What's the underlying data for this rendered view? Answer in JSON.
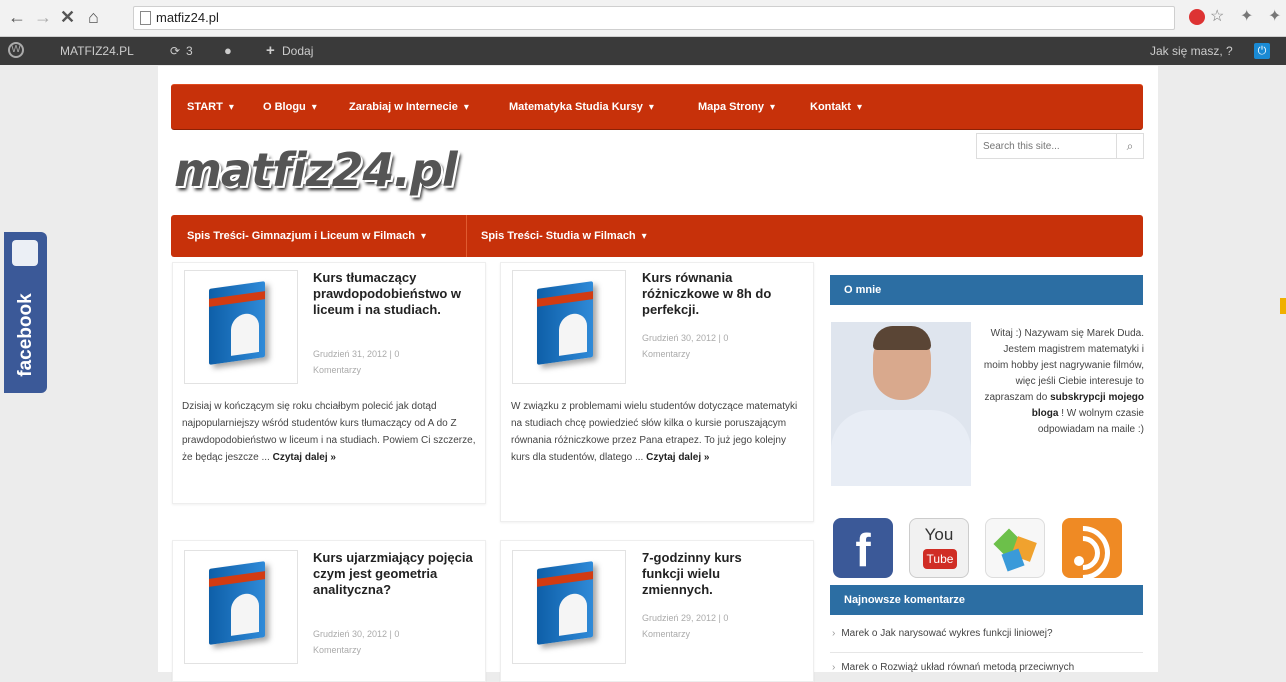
{
  "browser": {
    "url": "matfiz24.pl"
  },
  "wp_admin_bar": {
    "site_name": "MATFIZ24.PL",
    "updates_count": "3",
    "add_new": "Dodaj",
    "greeting": "Jak się masz, ?"
  },
  "header": {
    "logo_text": "matfiz24.pl",
    "search_placeholder": "Search this site..."
  },
  "main_menu": [
    {
      "label": "START"
    },
    {
      "label": "O Blogu"
    },
    {
      "label": "Zarabiaj w Internecie"
    },
    {
      "label": "Matematyka Studia Kursy"
    },
    {
      "label": "Mapa Strony"
    },
    {
      "label": "Kontakt"
    }
  ],
  "secondary_menu": [
    {
      "label": "Spis Treści- Gimnazjum i Liceum w Filmach"
    },
    {
      "label": "Spis Treści- Studia w Filmach"
    }
  ],
  "posts": [
    {
      "title": "Kurs tłumaczący prawdopodobieństwo w liceum i na studiach.",
      "date": "Grudzień 31, 2012 | 0",
      "comments": "Komentarzy",
      "excerpt": "Dzisiaj w kończącym się roku chciałbym polecić jak dotąd najpopularniejszy wśród studentów kurs tłumaczący od A do Z prawdopodobieństwo w liceum i na studiach. Powiem Ci szczerze, że będąc jeszcze ...",
      "read_more": "Czytaj dalej »"
    },
    {
      "title": "Kurs równania różniczkowe w 8h do perfekcji.",
      "date": "Grudzień 30, 2012 | 0",
      "comments": "Komentarzy",
      "excerpt": "W związku z problemami wielu studentów dotyczące matematyki na studiach chcę powiedzieć słów kilka o kursie poruszającym równania różniczkowe przez Pana etrapez. To już jego kolejny kurs dla studentów, dlatego ...",
      "read_more": "Czytaj dalej »"
    },
    {
      "title": "Kurs ujarzmiający pojęcia czym jest geometria analityczna?",
      "date": "Grudzień 30, 2012 | 0",
      "comments": "Komentarzy"
    },
    {
      "title": "7-godzinny kurs funkcji wielu zmiennych.",
      "date": "Grudzień 29, 2012 | 0",
      "comments": "Komentarzy"
    }
  ],
  "sidebar": {
    "about_title": "O mnie",
    "about_text_1": "Witaj :) Nazywam się Marek Duda. Jestem magistrem matematyki i moim hobby jest nagrywanie filmów, więc jeśli Ciebie interesuje to zapraszam do",
    "about_link": "subskrypcji mojego bloga",
    "about_text_2": "! W wolnym czasie odpowiadam na maile :)",
    "social": [
      {
        "name": "facebook-icon"
      },
      {
        "name": "youtube-icon",
        "top": "You",
        "bottom": "Tube"
      },
      {
        "name": "star-icon"
      },
      {
        "name": "rss-icon"
      }
    ],
    "comments_title": "Najnowsze komentarze",
    "comments": [
      {
        "text": "Marek o Jak narysować wykres funkcji liniowej?"
      },
      {
        "text": "Marek o Rozwiąż układ równań metodą przeciwnych"
      }
    ]
  },
  "facebook_tab": {
    "label": "facebook"
  }
}
